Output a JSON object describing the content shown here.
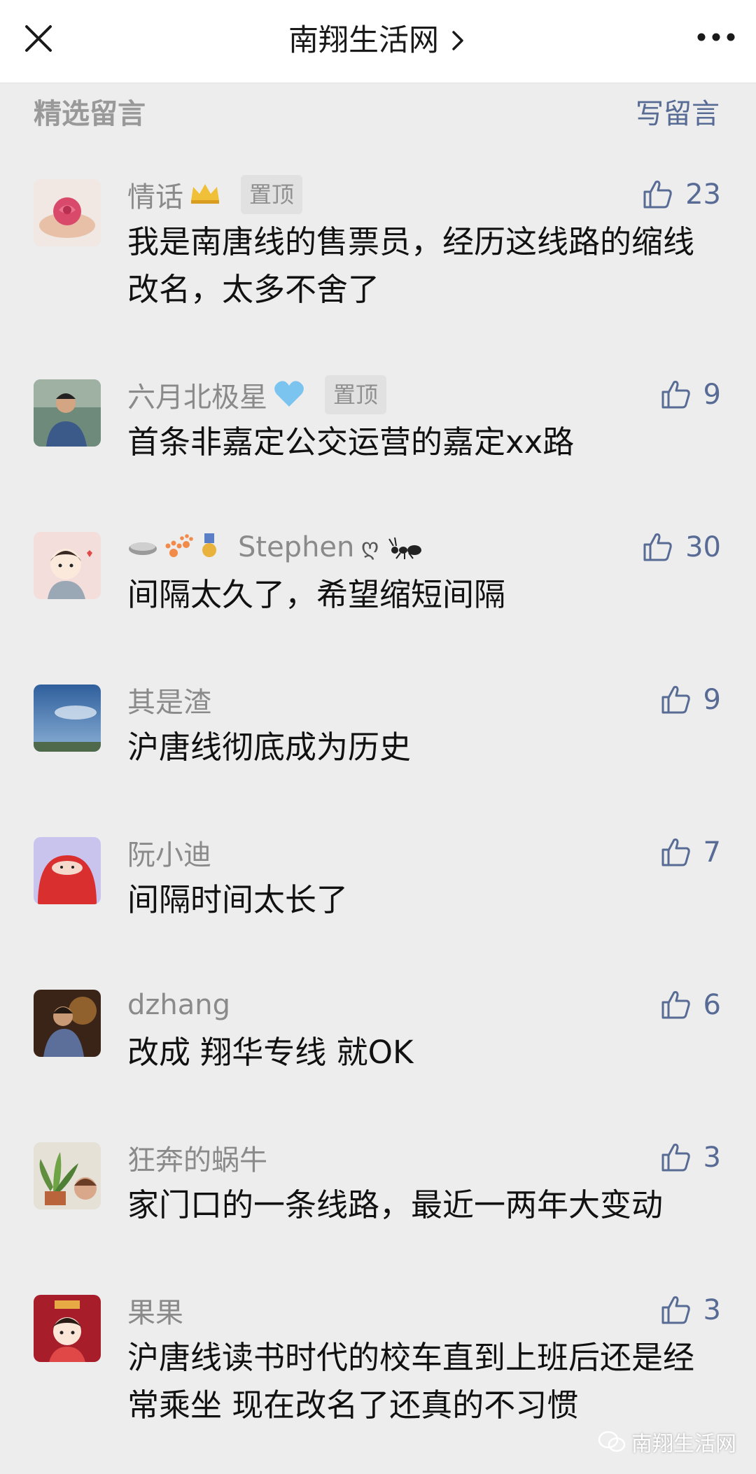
{
  "header": {
    "title": "南翔生活网"
  },
  "section": {
    "title": "精选留言",
    "write_label": "写留言"
  },
  "comments": [
    {
      "nick": "情话",
      "emoji": "👑",
      "pinned": "置顶",
      "likes": "23",
      "text": "我是南唐线的售票员，经历这线路的缩线改名，太多不舍了",
      "avatar": "rose-avatar"
    },
    {
      "nick": "六月北极星",
      "emoji": "💙",
      "pinned": "置顶",
      "likes": "9",
      "text": "首条非嘉定公交运营的嘉定xx路",
      "avatar": "person-photo-avatar"
    },
    {
      "nick": "Stephen",
      "emoji_prefix": "⚪🐾🎖️",
      "emoji": "ღ🐜",
      "likes": "30",
      "text": "间隔太久了，希望缩短间隔",
      "avatar": "cartoon-girl-avatar"
    },
    {
      "nick": "其是渣",
      "likes": "9",
      "text": "沪唐线彻底成为历史",
      "avatar": "sky-landscape-avatar"
    },
    {
      "nick": "阮小迪",
      "likes": "7",
      "text": "间隔时间太长了",
      "avatar": "red-cartoon-avatar"
    },
    {
      "nick": "dzhang",
      "likes": "6",
      "text": "改成 翔华专线 就OK",
      "avatar": "person-painting-avatar"
    },
    {
      "nick": "狂奔的蜗牛",
      "likes": "3",
      "text": "家门口的一条线路，最近一两年大变动",
      "avatar": "plant-photo-avatar"
    },
    {
      "nick": "果果",
      "likes": "3",
      "text": "沪唐线读书时代的校车直到上班后还是经常乘坐 现在改名了还真的不习惯",
      "avatar": "red-cartoon-girl-avatar"
    }
  ],
  "watermark": {
    "text": "南翔生活网"
  },
  "colors": {
    "link": "#576b95",
    "background": "#ededed",
    "nick": "#8a8a8a"
  }
}
